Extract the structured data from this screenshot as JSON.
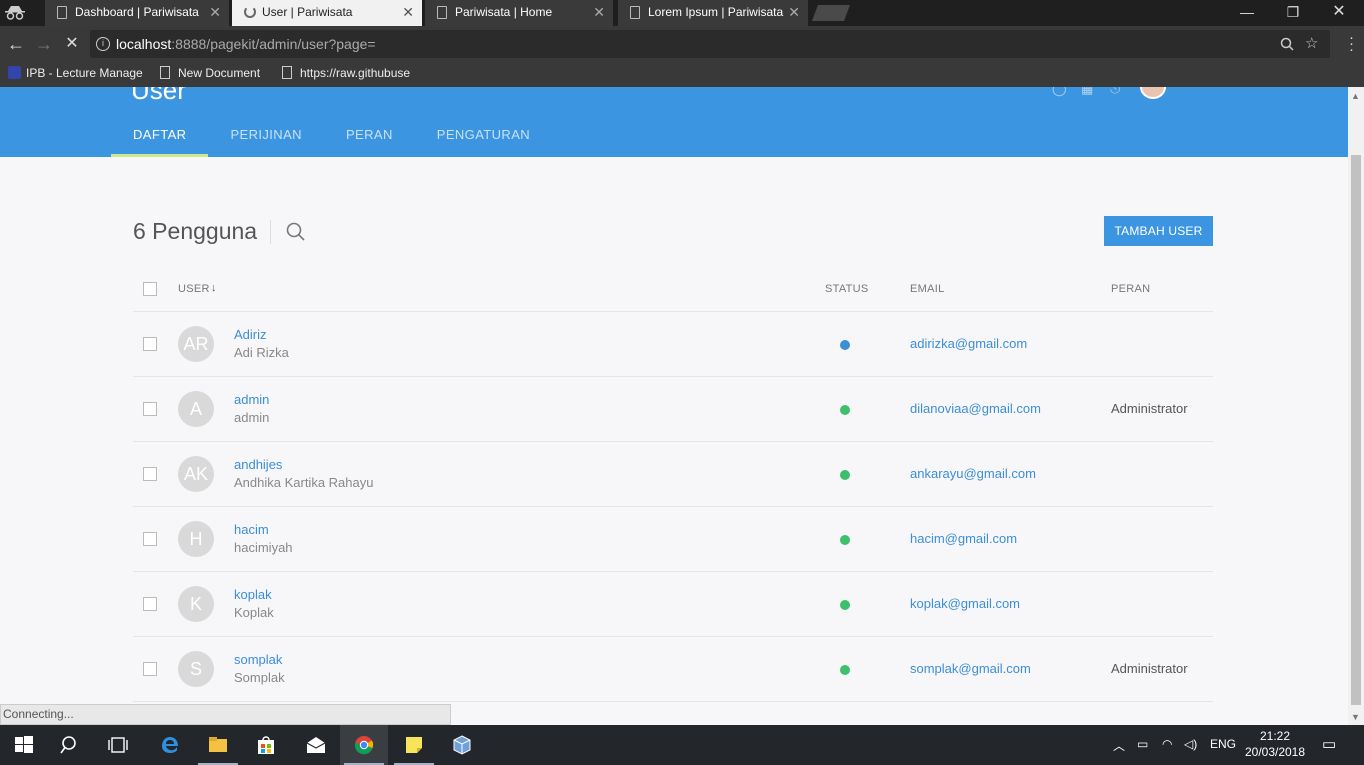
{
  "browser": {
    "tabs": [
      {
        "title": "Dashboard | Pariwisata",
        "active": false
      },
      {
        "title": "User | Pariwisata",
        "active": true
      },
      {
        "title": "Pariwisata | Home",
        "active": false
      },
      {
        "title": "Lorem Ipsum | Pariwisata",
        "active": false
      }
    ],
    "url_host": "localhost",
    "url_path": ":8888/pagekit/admin/user?page=",
    "bookmarks": [
      "IPB - Lecture Manage",
      "New Document",
      "https://raw.githubuse"
    ],
    "status_text": "Connecting..."
  },
  "page": {
    "title": "User",
    "nav": [
      "DAFTAR",
      "PERIJINAN",
      "PERAN",
      "PENGATURAN"
    ],
    "count_label": "6 Pengguna",
    "add_button": "TAMBAH USER",
    "columns": {
      "user": "USER",
      "status": "STATUS",
      "email": "EMAIL",
      "role": "PERAN"
    },
    "users": [
      {
        "initials": "AR",
        "username": "Adiriz",
        "name": "Adi Rizka",
        "status_color": "#3c8ed6",
        "email": "adirizka@gmail.com",
        "role": ""
      },
      {
        "initials": "A",
        "username": "admin",
        "name": "admin",
        "status_color": "#3cc06a",
        "email": "dilanoviaa@gmail.com",
        "role": "Administrator"
      },
      {
        "initials": "AK",
        "username": "andhijes",
        "name": "Andhika Kartika Rahayu",
        "status_color": "#3cc06a",
        "email": "ankarayu@gmail.com",
        "role": ""
      },
      {
        "initials": "H",
        "username": "hacim",
        "name": "hacimiyah",
        "status_color": "#3cc06a",
        "email": "hacim@gmail.com",
        "role": ""
      },
      {
        "initials": "K",
        "username": "koplak",
        "name": "Koplak",
        "status_color": "#3cc06a",
        "email": "koplak@gmail.com",
        "role": ""
      },
      {
        "initials": "S",
        "username": "somplak",
        "name": "Somplak",
        "status_color": "#3cc06a",
        "email": "somplak@gmail.com",
        "role": "Administrator"
      }
    ]
  },
  "taskbar": {
    "language": "ENG",
    "time": "21:22",
    "date": "20/03/2018"
  },
  "colors": {
    "accent": "#3c95e0",
    "active_tab_underline": "#cfe88a"
  }
}
